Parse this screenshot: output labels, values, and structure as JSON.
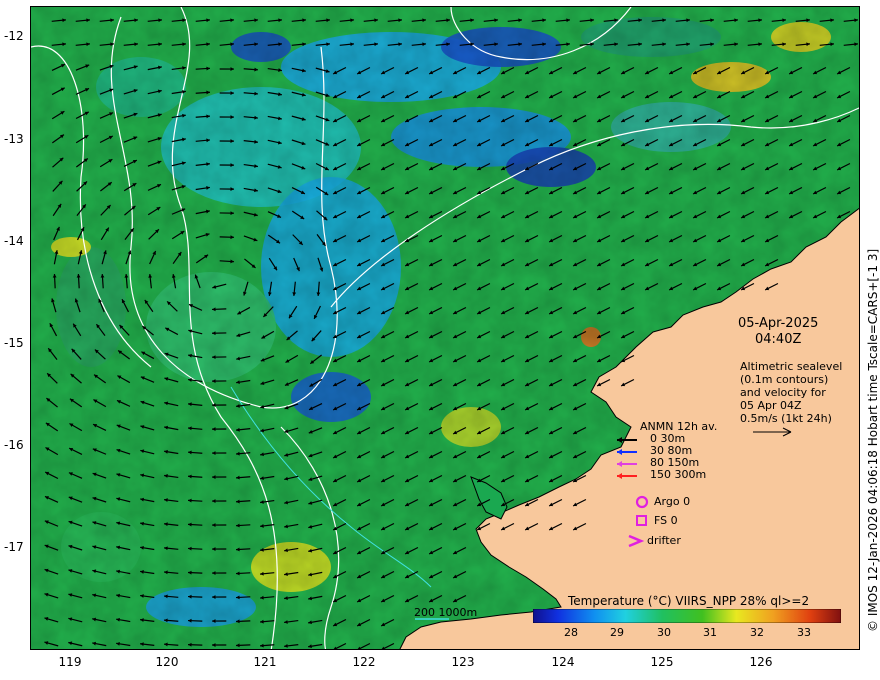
{
  "map": {
    "x_axis_labels": [
      "119",
      "120",
      "121",
      "122",
      "123",
      "124",
      "125",
      "126"
    ],
    "y_axis_labels": [
      "-12",
      "-13",
      "-14",
      "-15",
      "-16",
      "-17"
    ],
    "land_color": "#f8c89c",
    "coast_color": "#000000",
    "contour_color": "#ffffff",
    "isobath_color": "#40e0e0"
  },
  "date": {
    "line1": "05-Apr-2025",
    "line2": "04:40Z"
  },
  "altimetry": {
    "lines": [
      "Altimetric sealevel",
      "(0.1m contours)",
      "and velocity for",
      "05 Apr 04Z",
      "0.5m/s (1kt 24h)"
    ]
  },
  "anmn_legend": {
    "title": "ANMN 12h av.",
    "items": [
      {
        "label": "0 30m",
        "color": "#000000"
      },
      {
        "label": "30 80m",
        "color": "#1030ff"
      },
      {
        "label": "80 150m",
        "color": "#e040e0"
      },
      {
        "label": "150 300m",
        "color": "#ff2020"
      }
    ]
  },
  "markers": {
    "argo": {
      "label": "Argo 0",
      "color": "#e020e0",
      "icon": "circle-icon"
    },
    "fs": {
      "label": "FS 0",
      "color": "#e020e0",
      "icon": "square-icon"
    },
    "drifter": {
      "label": "drifter",
      "color": "#e020e0",
      "icon": "chevron-icon"
    }
  },
  "colorbar": {
    "title": "Temperature (°C) VIIRS_NPP 28% ql>=2",
    "ticks": [
      "28",
      "29",
      "30",
      "31",
      "32",
      "33"
    ]
  },
  "isobath_label": "200  1000m",
  "side_caption": "© IMOS 12-Jan-2026 04:06:18 Hobart time Tscale=CARS+[-1 3]"
}
